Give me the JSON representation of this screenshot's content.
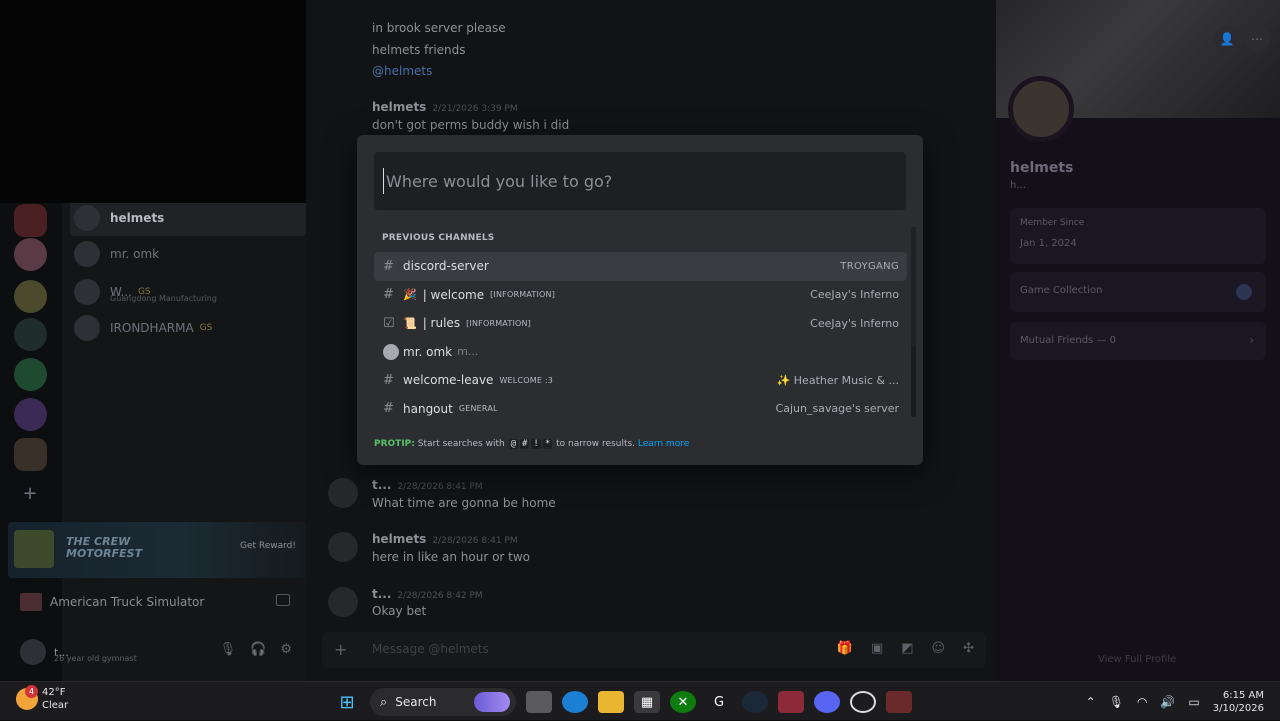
{
  "chat": {
    "messages_top": [
      {
        "text": "in brook server please"
      },
      {
        "text": "helmets friends"
      },
      {
        "text": "@helmets"
      }
    ],
    "msg_helmets_1": {
      "author": "helmets",
      "time": "2/21/2026 3:39 PM",
      "text": "don't got perms buddy wish i did"
    },
    "msg_t_1": {
      "author": "t...",
      "time": "2/28/2026 8:41 PM",
      "text": "What time are gonna be home"
    },
    "msg_helmets_2": {
      "author": "helmets",
      "time": "2/28/2026 8:41 PM",
      "text": "here in like an hour or two"
    },
    "msg_t_2": {
      "author": "t...",
      "time": "2/28/2026 8:42 PM",
      "text": "Okay bet"
    },
    "input_placeholder": "Message @helmets"
  },
  "sidebar": {
    "dms": [
      {
        "name": "helmets"
      },
      {
        "name": "mr. omk"
      },
      {
        "name": "W...",
        "tag": "GS",
        "sub": "Guangdong Manufacturing"
      },
      {
        "name": "IRONDHARMA",
        "tag": "GS"
      }
    ],
    "promo": {
      "title": "THE CREW MOTORFEST",
      "button": "Get Reward!"
    },
    "activity": "American Truck Simulator",
    "user": {
      "name": "t...",
      "status": "26 year old gymnast"
    }
  },
  "quick_switcher": {
    "placeholder": "Where would you like to go?",
    "header": "PREVIOUS CHANNELS",
    "items": [
      {
        "name": "discord-server",
        "server": "TROYGANG"
      },
      {
        "emoji": "🎉",
        "name": "| welcome",
        "category": "[INFORMATION]",
        "server": "CeeJay's Inferno"
      },
      {
        "emoji": "📜",
        "name": "| rules",
        "category": "[INFORMATION]",
        "server": "CeeJay's Inferno"
      },
      {
        "name": "mr. omk",
        "sub": "m..."
      },
      {
        "name": "welcome-leave",
        "category": "WELCOME :3",
        "server": "✨ Heather Music & ..."
      },
      {
        "name": "hangout",
        "category": "GENERAL",
        "server": "Cajun_savage's server"
      }
    ],
    "protip": {
      "label": "PROTIP:",
      "text": "Start searches with",
      "keys": [
        "@",
        "#",
        "!",
        "*"
      ],
      "tail": "to narrow results.",
      "link": "Learn more"
    }
  },
  "profile": {
    "name": "helmets",
    "username": "h...",
    "member_since_label": "Member Since",
    "member_since": "Jan 1, 2024",
    "game_collection": "Game Collection",
    "mutual_friends": "Mutual Friends — 0",
    "view_full": "View Full Profile"
  },
  "taskbar": {
    "temp": "42°F",
    "weather": "Clear",
    "weather_badge": "4",
    "search": "Search",
    "time": "6:15 AM",
    "date": "3/10/2026"
  }
}
